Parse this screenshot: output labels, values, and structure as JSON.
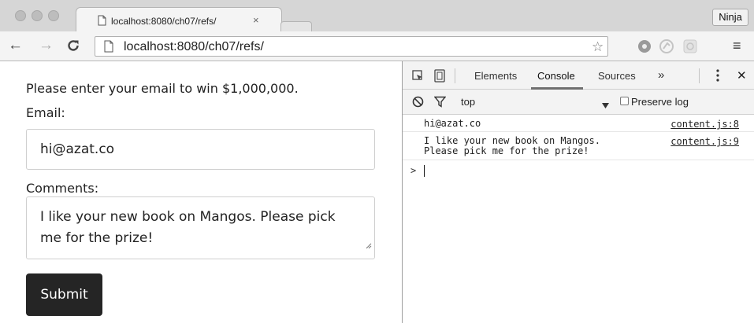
{
  "browser": {
    "tab_title": "localhost:8080/ch07/refs/",
    "tab_close": "×",
    "profile_button": "Ninja",
    "url": "localhost:8080/ch07/refs/",
    "nav": {
      "back": "←",
      "forward": "→"
    },
    "menu_icon": "≡"
  },
  "page": {
    "intro": "Please enter your email to win $1,000,000.",
    "email_label": "Email:",
    "email_value": "hi@azat.co",
    "comments_label": "Comments:",
    "comments_value": "I like your new book on Mangos. Please pick me for the prize!",
    "submit_label": "Submit"
  },
  "devtools": {
    "tabs": [
      "Elements",
      "Console",
      "Sources",
      "»"
    ],
    "active_tab": "Console",
    "close": "✕",
    "context": "top",
    "preserve_log_label": "Preserve log",
    "messages": [
      {
        "text": "hi@azat.co",
        "source": "content.js:8"
      },
      {
        "text": "I like your new book on Mangos.\nPlease pick me for the prize!",
        "source": "content.js:9"
      }
    ],
    "prompt": ">"
  },
  "colors": {
    "submit_bg": "#252525",
    "chrome_bg": "#d6d6d6",
    "toolbar_bg": "#f4f4f4"
  },
  "icons": [
    "page-icon",
    "reload-icon",
    "bookmark-star-icon",
    "extension-icon",
    "inspect-icon",
    "device-icon",
    "clear-console-icon",
    "filter-icon",
    "more-vertical-icon",
    "dropdown-arrow-icon",
    "resize-grip-icon"
  ]
}
